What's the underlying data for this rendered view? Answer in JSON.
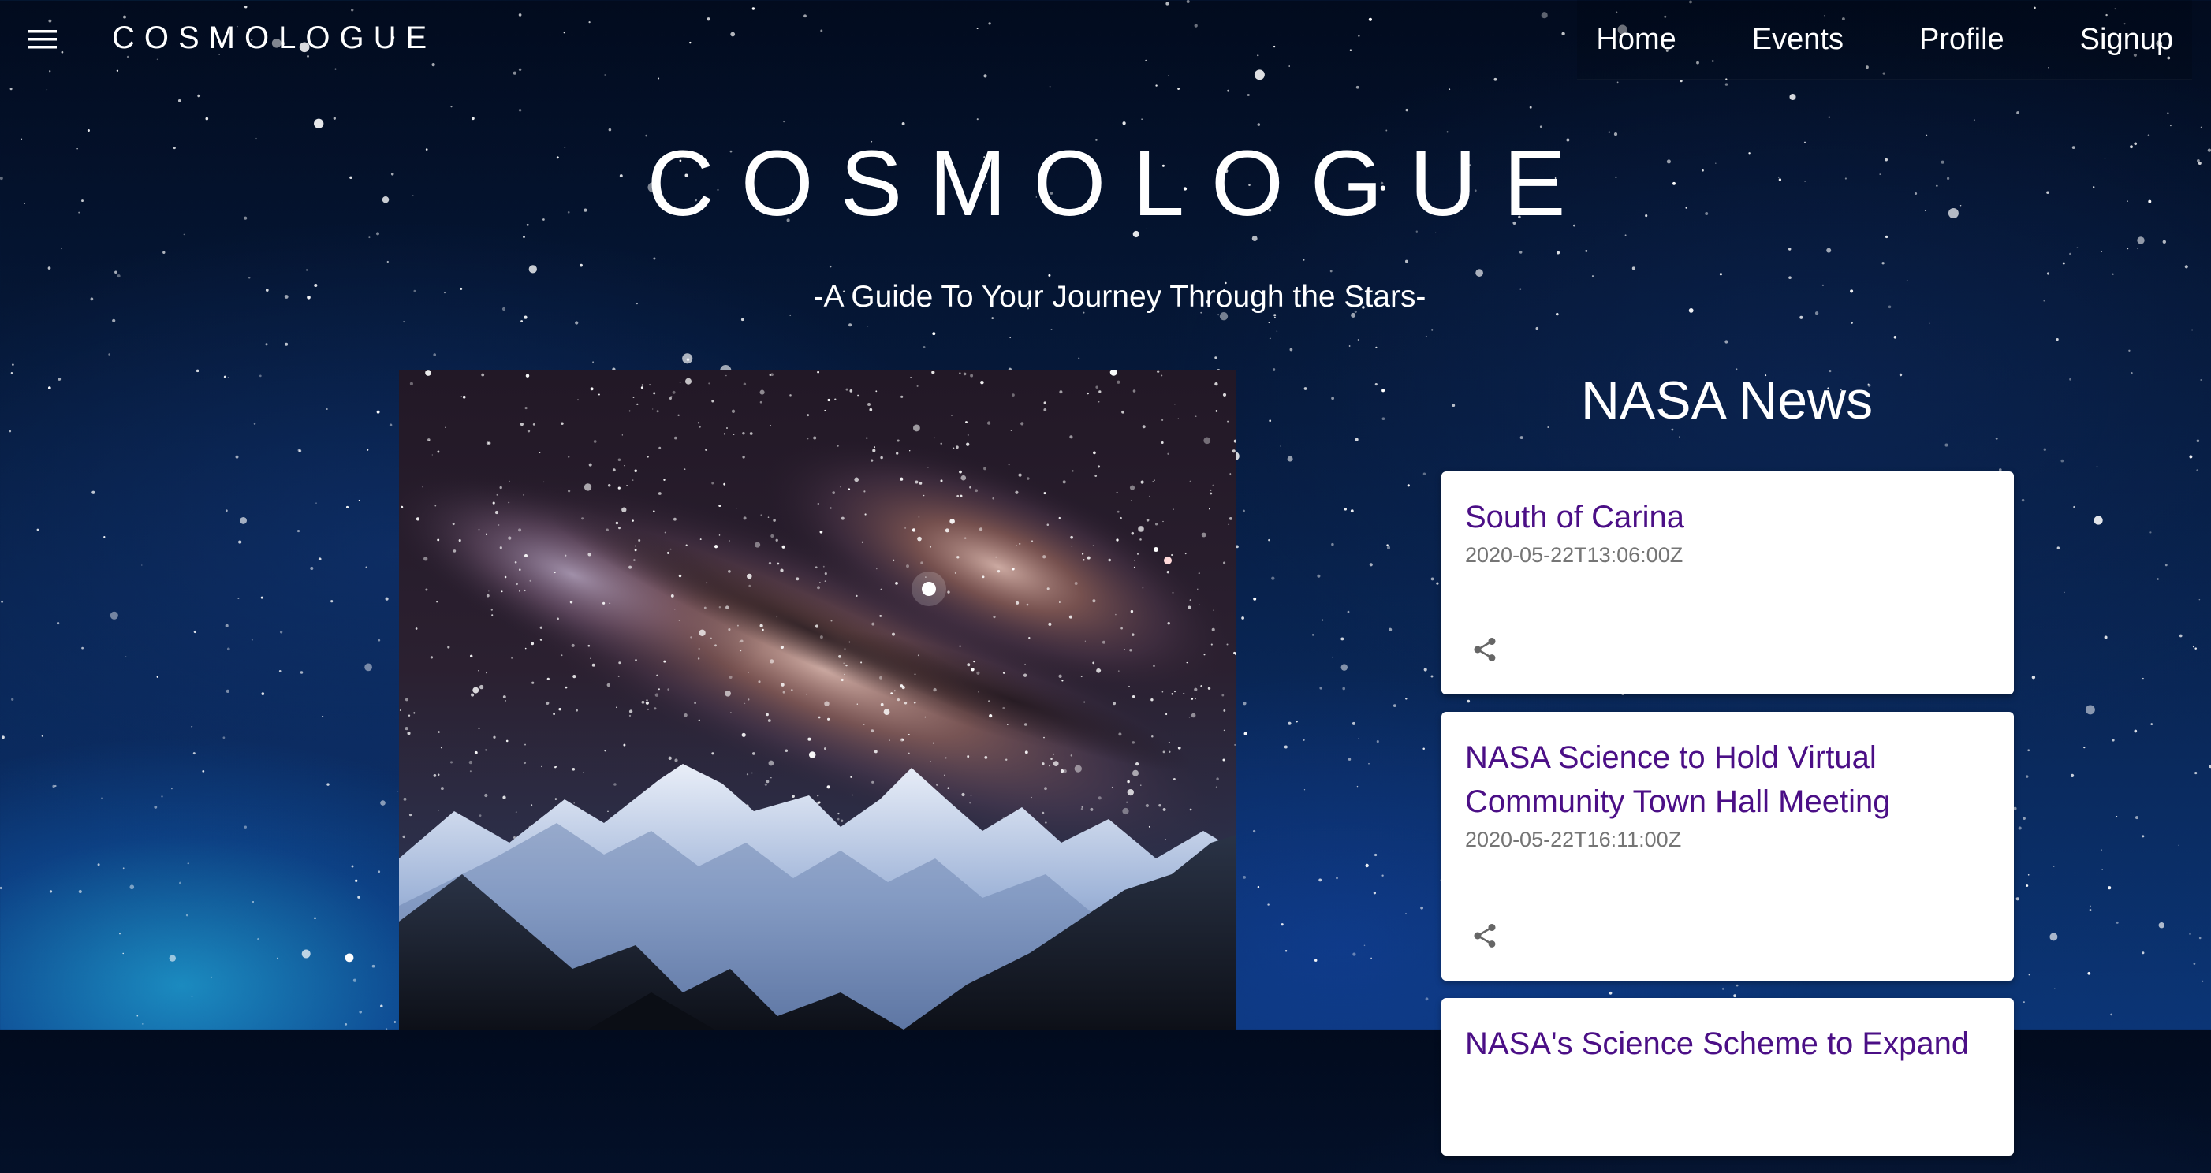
{
  "header": {
    "brand": "COSMOLOGUE",
    "nav": [
      "Home",
      "Events",
      "Profile",
      "Signup"
    ]
  },
  "hero": {
    "title": "COSMOLOGUE",
    "subtitle": "-A Guide To Your Journey Through the Stars-"
  },
  "news": {
    "heading": "NASA News",
    "items": [
      {
        "title": "South of Carina",
        "date": "2020-05-22T13:06:00Z"
      },
      {
        "title": "NASA Science to Hold Virtual Community Town Hall Meeting",
        "date": "2020-05-22T16:11:00Z"
      },
      {
        "title": "NASA's Science Scheme to Expand",
        "date": ""
      }
    ]
  },
  "colors": {
    "news_title": "#4b0f86",
    "news_date": "#757575",
    "card_bg": "#ffffff"
  },
  "icons": {
    "menu": "menu-icon",
    "share": "share-icon"
  }
}
